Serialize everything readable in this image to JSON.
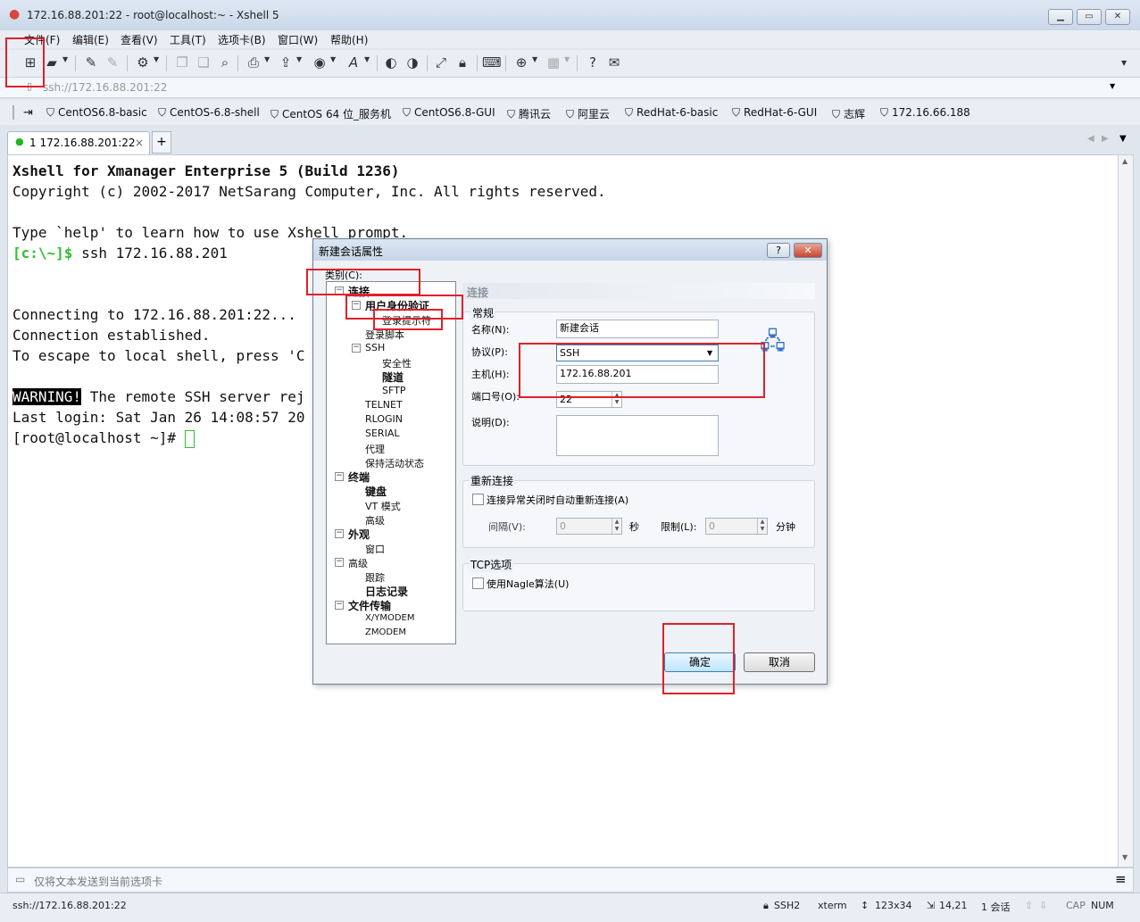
{
  "window": {
    "title": "172.16.88.201:22 - root@localhost:~ - Xshell 5"
  },
  "menu": [
    "文件(F)",
    "编辑(E)",
    "查看(V)",
    "工具(T)",
    "选项卡(B)",
    "窗口(W)",
    "帮助(H)"
  ],
  "address": {
    "value": "ssh://172.16.88.201:22"
  },
  "links": [
    "CentOS6.8-basic",
    "CentOS-6.8-shell",
    "CentOS 64 位_服务机",
    "CentOS6.8-GUI",
    "腾讯云",
    "阿里云",
    "RedHat-6-basic",
    "RedHat-6-GUI",
    "志辉",
    "172.16.66.188"
  ],
  "tab": {
    "label": "1 172.16.88.201:22",
    "close": "×",
    "plus": "+"
  },
  "terminal": {
    "line1": "Xshell for Xmanager Enterprise 5 (Build 1236)",
    "line2": "Copyright (c) 2002-2017 NetSarang Computer, Inc. All rights reserved.",
    "line3": "Type `help' to learn how to use Xshell prompt.",
    "prompt": "[c:\\~]$",
    "cmd": " ssh 172.16.88.201",
    "line5": "Connecting to 172.16.88.201:22...",
    "line6": "Connection established.",
    "line7": "To escape to local shell, press 'C",
    "warn": "WARNING!",
    "line8": " The remote SSH server rej",
    "line9": "Last login: Sat Jan 26 14:08:57 20",
    "line10": "[root@localhost ~]# "
  },
  "compose": {
    "placeholder": "仅将文本发送到当前选项卡"
  },
  "status": {
    "addr": "ssh://172.16.88.201:22",
    "proto": "SSH2",
    "term": "xterm",
    "size": "123x34",
    "pos": "14,21",
    "sessions": "1 会话",
    "cap": "CAP",
    "num": "NUM"
  },
  "dialog": {
    "title": "新建会话属性",
    "help": "?",
    "close": "✕",
    "category_label": "类别(C):",
    "section": "连接",
    "tree": {
      "connect": "连接",
      "auth": "用户身份验证",
      "login_prompt": "登录提示符",
      "login_script": "登录脚本",
      "ssh": "SSH",
      "security": "安全性",
      "tunnel": "隧道",
      "sftp": "SFTP",
      "telnet": "TELNET",
      "rlogin": "RLOGIN",
      "serial": "SERIAL",
      "proxy": "代理",
      "keepalive": "保持活动状态",
      "terminal": "终端",
      "keyboard": "键盘",
      "vt": "VT 模式",
      "advanced1": "高级",
      "appearance": "外观",
      "window": "窗口",
      "advanced": "高级",
      "trace": "跟踪",
      "log": "日志记录",
      "filetransfer": "文件传输",
      "xymodem": "X/YMODEM",
      "zmodem": "ZMODEM"
    },
    "general": {
      "group": "常规",
      "name_label": "名称(N):",
      "name_value": "新建会话",
      "protocol_label": "协议(P):",
      "protocol_value": "SSH",
      "host_label": "主机(H):",
      "host_value": "172.16.88.201",
      "port_label": "端口号(O):",
      "port_value": "22",
      "desc_label": "说明(D):"
    },
    "reconnect": {
      "group": "重新连接",
      "auto_label": "连接异常关闭时自动重新连接(A)",
      "interval_label": "间隔(V):",
      "interval_value": "0",
      "seconds": "秒",
      "limit_label": "限制(L):",
      "limit_value": "0",
      "minutes": "分钟"
    },
    "tcp": {
      "group": "TCP选项",
      "nagle_label": "使用Nagle算法(U)"
    },
    "ok": "确定",
    "cancel": "取消"
  }
}
